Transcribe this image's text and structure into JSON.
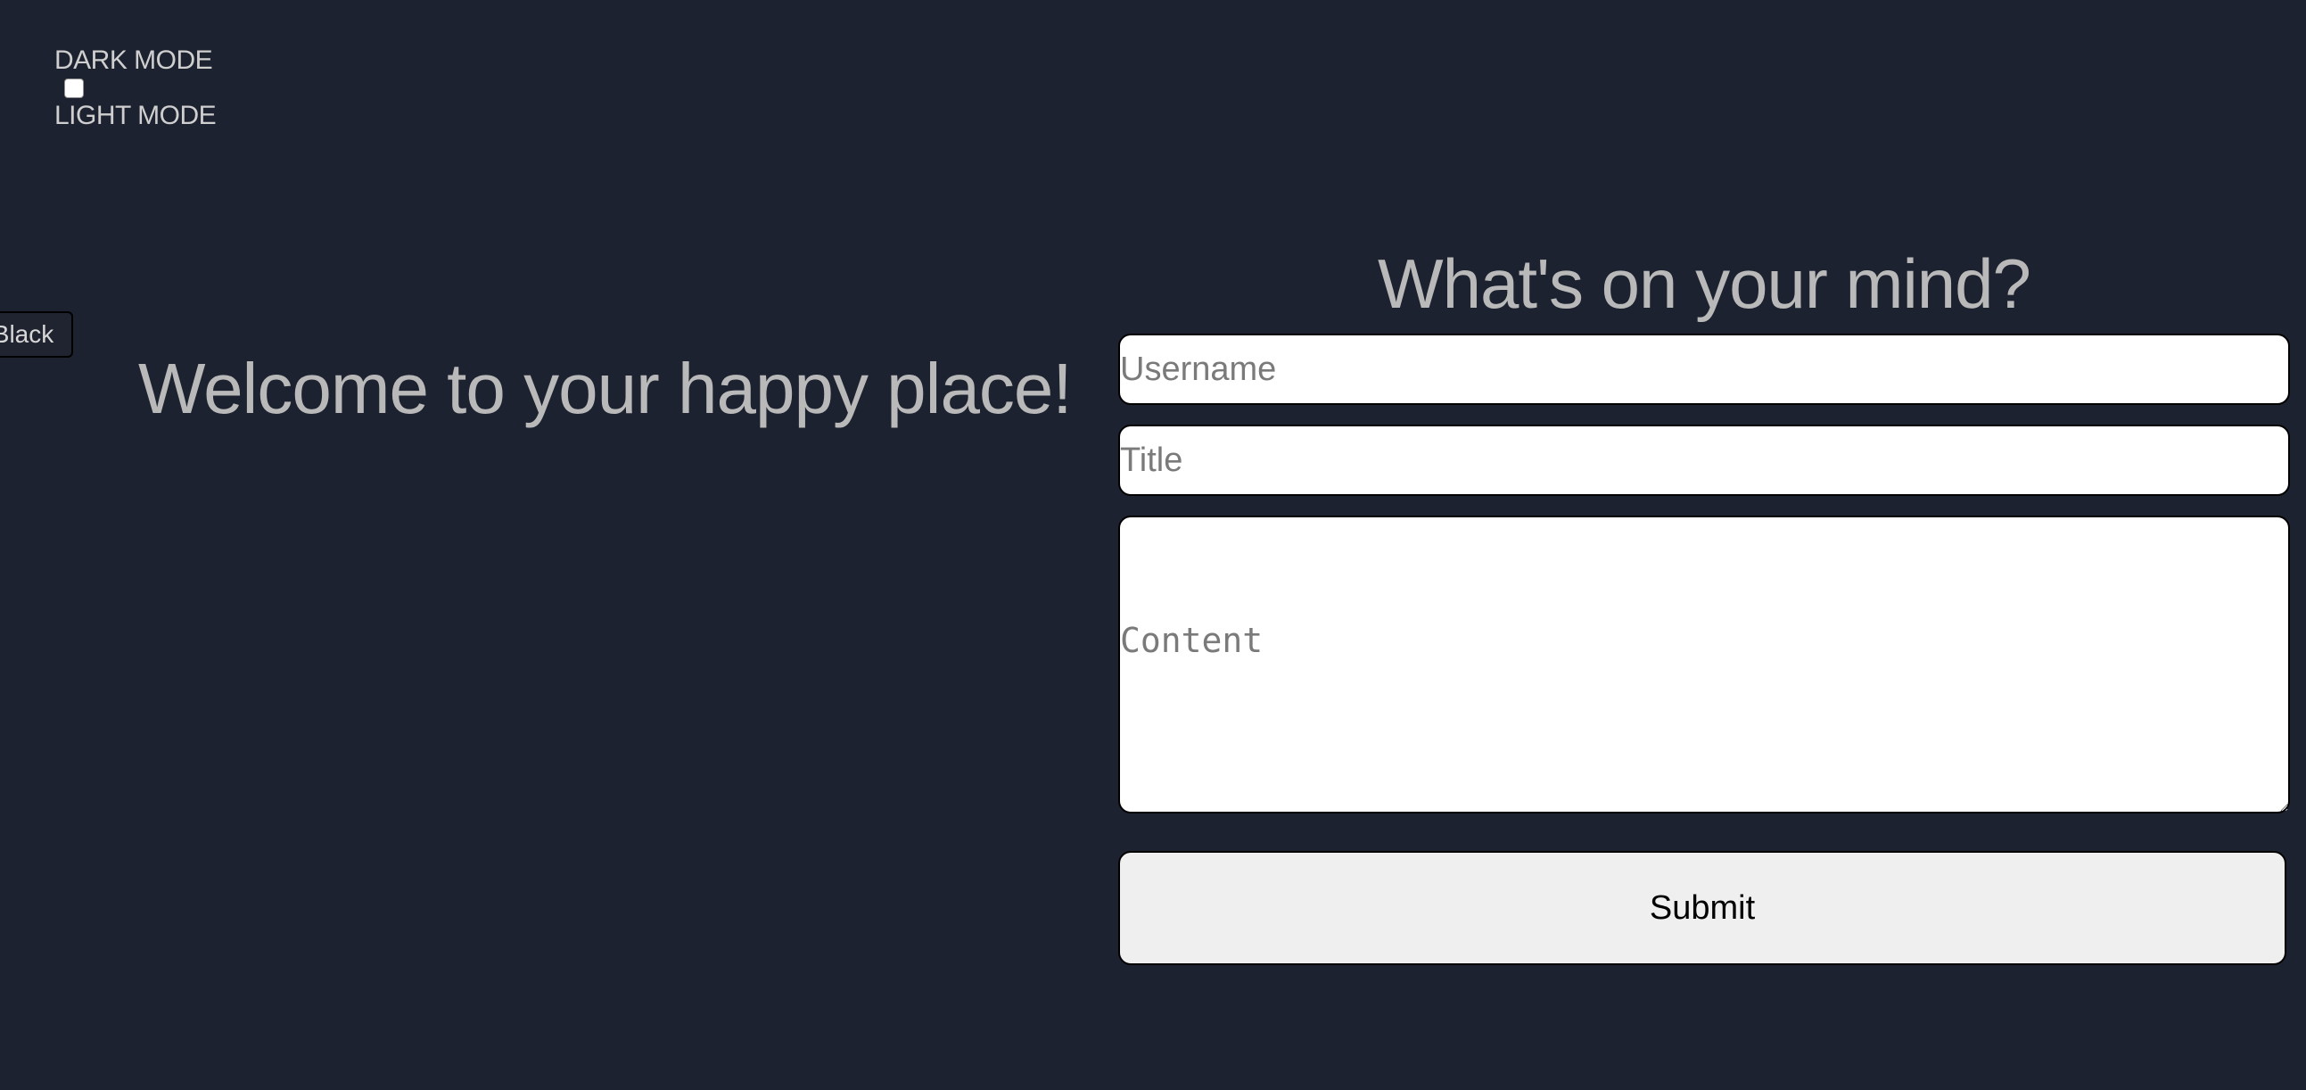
{
  "theme_toggle": {
    "dark_label": "DARK MODE",
    "light_label": "LIGHT MODE",
    "checked": false
  },
  "black_button": {
    "label": "Black"
  },
  "welcome": {
    "heading": "Welcome to your happy place!"
  },
  "post_form": {
    "heading": "What's on your mind?",
    "username_placeholder": "Username",
    "title_placeholder": "Title",
    "content_placeholder": "Content",
    "submit_label": "Submit"
  },
  "colors": {
    "background": "#1d2230",
    "heading_text": "#b9b9b9",
    "field_background": "#ffffff",
    "button_background": "#efefef"
  }
}
